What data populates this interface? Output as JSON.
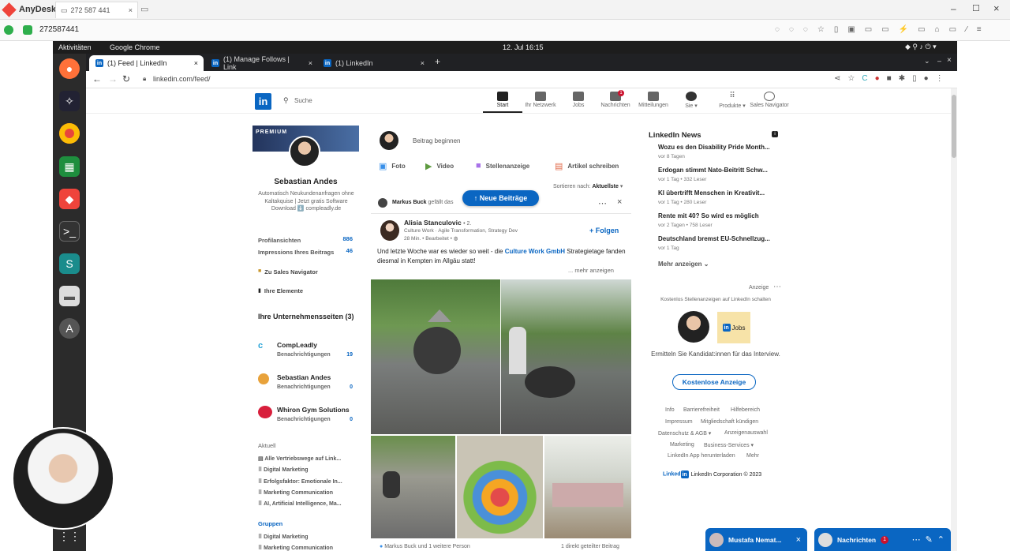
{
  "anydesk": {
    "app_name": "AnyDesk",
    "tab_address": "272 587 441",
    "address_value": "272587441"
  },
  "gnome": {
    "activities": "Aktivitäten",
    "app": "Google Chrome",
    "clock": "12. Jul  16:15"
  },
  "chrome": {
    "tabs": [
      {
        "label": "(1) Feed | LinkedIn"
      },
      {
        "label": "(1) Manage Follows | Link"
      },
      {
        "label": "(1) LinkedIn"
      }
    ],
    "url": "linkedin.com/feed/"
  },
  "linkedin": {
    "search_placeholder": "Suche",
    "nav": [
      {
        "label": "Start",
        "badge": ""
      },
      {
        "label": "Ihr Netzwerk"
      },
      {
        "label": "Jobs"
      },
      {
        "label": "Nachrichten",
        "badge": "1"
      },
      {
        "label": "Mitteilungen"
      },
      {
        "label": "Sie ▾"
      },
      {
        "label": "Produkte ▾"
      },
      {
        "label": "Sales Navigator"
      }
    ],
    "profile": {
      "banner": "PREMIUM",
      "name": "Sebastian Andes",
      "headline": "Automatisch Neukundenanfragen ohne Kaltakquise | Jetzt gratis Software Download ⬇️ compleadly.de",
      "stats": [
        {
          "label": "Profilansichten",
          "value": "886"
        },
        {
          "label": "Impressions Ihres Beitrags",
          "value": "46"
        }
      ],
      "sales_nav": "Zu Sales Navigator",
      "items": "Ihre Elemente"
    },
    "companies": {
      "title": "Ihre Unternehmensseiten (3)",
      "list": [
        {
          "name": "CompLeadly",
          "sub": "Benachrichtigungen",
          "count": "19"
        },
        {
          "name": "Sebastian Andes",
          "sub": "Benachrichtigungen",
          "count": "0"
        },
        {
          "name": "Whiron Gym Solutions",
          "sub": "Benachrichtigungen",
          "count": "0"
        }
      ]
    },
    "recent": {
      "title": "Aktuell",
      "items": [
        "Alle Vertriebswege auf Link...",
        "Digital Marketing",
        "Erfolgsfaktor: Emotionale In...",
        "Marketing Communication",
        "AI, Artificial Intelligence, Ma..."
      ]
    },
    "groups": {
      "title": "Gruppen",
      "items": [
        "Digital Marketing",
        "Marketing Communication"
      ]
    },
    "composer": {
      "placeholder": "Beitrag beginnen",
      "actions": [
        "Foto",
        "Video",
        "Stellenanzeige",
        "Artikel schreiben"
      ]
    },
    "sort": {
      "label": "Sortieren nach:",
      "value": "Aktuellste"
    },
    "post": {
      "liked_by": "Markus Buck",
      "liked_suffix": "gefällt das",
      "new_posts": "↑ Neue Beiträge",
      "author": "Alisia Stanculovic",
      "degree": "• 2.",
      "author_sub": "Culture Work · Agile Transformation, Strategy Dev",
      "time": "28 Min. • Bearbeitet •",
      "follow": "+ Folgen",
      "text_before": "Und letzte Woche war es wieder so weit - die ",
      "text_link": "Culture Work GmbH",
      "text_after": " Strategietage fanden diesmal in Kempten im Allgäu statt!",
      "more": "... mehr anzeigen",
      "reactions": "Markus Buck und 1 weitere Person",
      "shares": "1 direkt geteilter Beitrag"
    },
    "news": {
      "title": "LinkedIn News",
      "items": [
        {
          "h": "Wozu es den Disability Pride Month...",
          "s": "vor 8 Tagen"
        },
        {
          "h": "Erdogan stimmt Nato-Beitritt Schw...",
          "s": "vor 1 Tag • 332 Leser"
        },
        {
          "h": "KI übertrifft Menschen in Kreativit...",
          "s": "vor 1 Tag • 280 Leser"
        },
        {
          "h": "Rente mit 40? So wird es möglich",
          "s": "vor 2 Tagen • 758 Leser"
        },
        {
          "h": "Deutschland bremst EU-Schnellzug...",
          "s": "vor 1 Tag"
        }
      ],
      "more": "Mehr anzeigen ⌄"
    },
    "ad": {
      "label": "Anzeige",
      "sub": "Kostenlos Stellenanzeigen auf LinkedIn schalten",
      "text": "Ermitteln Sie Kandidat:innen für das Interview.",
      "cta": "Kostenlose Anzeige",
      "jobs": "Jobs"
    },
    "footer": [
      "Info",
      "Barrierefreiheit",
      "Hilfebereich",
      "Impressum",
      "Mitgliedschaft kündigen",
      "Datenschutz & AGB ▾",
      "Anzeigenauswahl",
      "Marketing",
      "Business-Services ▾",
      "LinkedIn App herunterladen",
      "Mehr"
    ],
    "copyright": "LinkedIn Corporation © 2023",
    "chat": [
      {
        "name": "Mustafa Nemat..."
      },
      {
        "name": "Nachrichten",
        "badge": "1"
      }
    ]
  },
  "colors": {
    "linkedin_blue": "#0a66c2",
    "anydesk_red": "#ef443b"
  }
}
